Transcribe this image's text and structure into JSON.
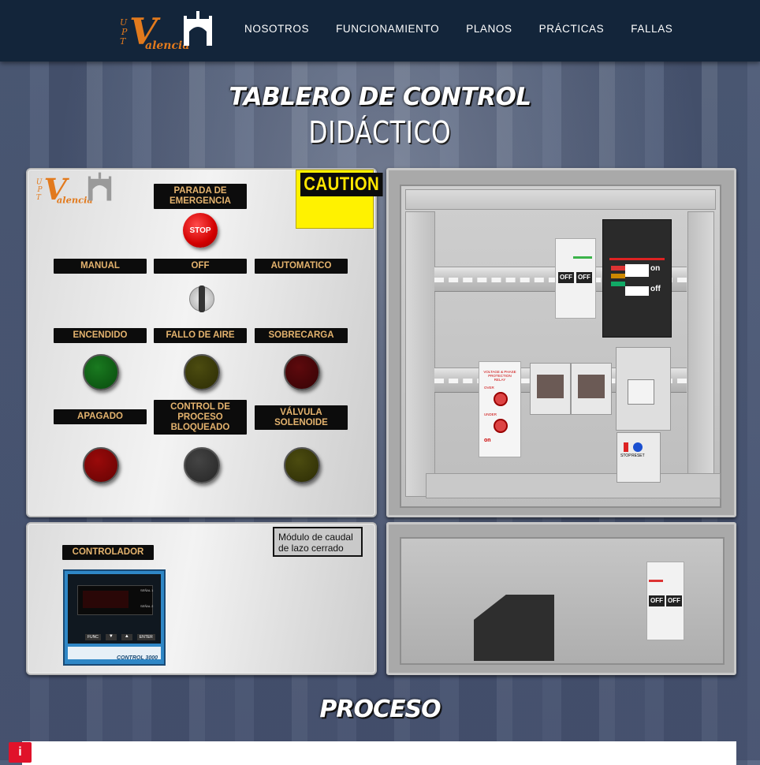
{
  "nav": {
    "brand_prefix": "UPT",
    "brand_name": "Valencia",
    "items": [
      "NOSOTROS",
      "FUNCIONAMIENTO",
      "PLANOS",
      "PRÁCTICAS",
      "FALLAS"
    ]
  },
  "hero": {
    "title_line1": "TABLERO DE CONTROL",
    "title_line2": "DIDÁCTICO"
  },
  "control_panel": {
    "caution": "CAUTION",
    "emergency_label": "PARADA DE EMERGENCIA",
    "stop_button": "STOP",
    "selector_labels": [
      "MANUAL",
      "OFF",
      "AUTOMATICO"
    ],
    "indicators_row1": [
      "ENCENDIDO",
      "FALLO DE AIRE",
      "SOBRECARGA"
    ],
    "indicators_row2": [
      "APAGADO",
      "CONTROL DE PROCESO BLOQUEADO",
      "VÁLVULA SOLENOIDE"
    ],
    "lamp_colors": [
      "#0b5a12",
      "#3a3a08",
      "#4a0508",
      "#7a0505",
      "#333333",
      "#3a3a08"
    ]
  },
  "controller_panel": {
    "label": "CONTROLADOR",
    "module_label": "Módulo de caudal de lazo cerrado",
    "device_name": "CONTROL 3000",
    "keys": [
      "FUNC",
      "▼",
      "▲",
      "ENTER"
    ],
    "signals": [
      "SEÑAL 1",
      "SEÑAL 2"
    ]
  },
  "cabinet": {
    "breaker_off": "OFF",
    "mccb_on": "on",
    "mccb_off": "off",
    "relay_title": "VOLTAGE & PHASE PROTECTION RELAY",
    "relay_over": "OVER",
    "relay_under": "UNDER",
    "relay_on": "on",
    "overload_buttons": [
      "STOP",
      "RESET"
    ]
  },
  "section_title": "PROCESO",
  "info_icon": "i"
}
